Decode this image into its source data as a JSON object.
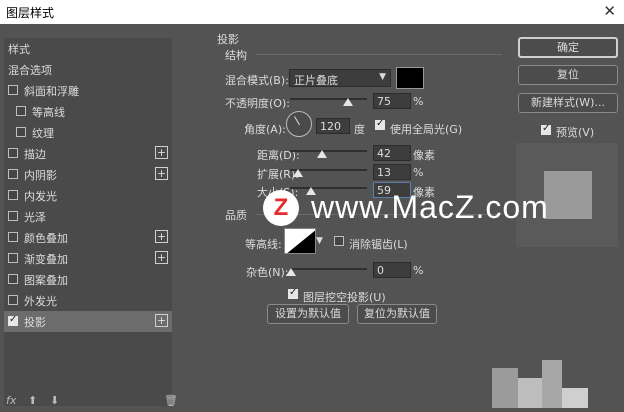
{
  "window": {
    "title": "图层样式",
    "close_glyph": "✕"
  },
  "sidebar": {
    "items": [
      {
        "label": "样式",
        "type": "header",
        "checked": false,
        "plus": false
      },
      {
        "label": "混合选项",
        "type": "header",
        "checked": false,
        "plus": false
      },
      {
        "label": "斜面和浮雕",
        "type": "item",
        "checked": false,
        "plus": false
      },
      {
        "label": "等高线",
        "type": "sub",
        "checked": false,
        "plus": false
      },
      {
        "label": "纹理",
        "type": "sub",
        "checked": false,
        "plus": false
      },
      {
        "label": "描边",
        "type": "item",
        "checked": false,
        "plus": true
      },
      {
        "label": "内阴影",
        "type": "item",
        "checked": false,
        "plus": true
      },
      {
        "label": "内发光",
        "type": "item",
        "checked": false,
        "plus": false
      },
      {
        "label": "光泽",
        "type": "item",
        "checked": false,
        "plus": false
      },
      {
        "label": "颜色叠加",
        "type": "item",
        "checked": false,
        "plus": true
      },
      {
        "label": "渐变叠加",
        "type": "item",
        "checked": false,
        "plus": true
      },
      {
        "label": "图案叠加",
        "type": "item",
        "checked": false,
        "plus": false
      },
      {
        "label": "外发光",
        "type": "item",
        "checked": false,
        "plus": false
      },
      {
        "label": "投影",
        "type": "item",
        "checked": true,
        "plus": true,
        "selected": true
      }
    ],
    "footer": {
      "fx": "fx",
      "up": "⬆",
      "down": "⬇",
      "trash": "🗑"
    }
  },
  "panel": {
    "section_title": "投影",
    "structure_title": "结构",
    "blend_mode_label": "混合模式(B):",
    "blend_mode_value": "正片叠底",
    "opacity_label": "不透明度(O):",
    "opacity_value": "75",
    "opacity_unit": "%",
    "opacity_level": 0.75,
    "angle_label": "角度(A):",
    "angle_value": "120",
    "angle_unit": "度",
    "global_light_label": "使用全局光(G)",
    "global_light_checked": true,
    "distance_label": "距离(D):",
    "distance_value": "42",
    "distance_unit": "像素",
    "spread_label": "扩展(R):",
    "spread_value": "13",
    "spread_unit": "%",
    "size_label": "大小(S):",
    "size_value": "59",
    "size_unit": "像素",
    "quality_title": "品质",
    "contour_label": "等高线:",
    "antialias_label": "消除锯齿(L)",
    "antialias_checked": false,
    "noise_label": "杂色(N):",
    "noise_value": "0",
    "noise_unit": "%",
    "knockout_label": "图层挖空投影(U)",
    "knockout_checked": true,
    "make_default_label": "设置为默认值",
    "reset_default_label": "复位为默认值"
  },
  "actions": {
    "ok_label": "确定",
    "reset_label": "复位",
    "new_style_label": "新建样式(W)...",
    "preview_label": "预览(V)",
    "preview_checked": true
  },
  "watermark": {
    "logo_letter": "Z",
    "text": "www.MacZ.com"
  },
  "colors": {
    "dialog_bg": "#535353",
    "sidebar_bg": "#4a4a4a",
    "shadow_color": "#000000",
    "logo_red": "#e52d2d"
  }
}
